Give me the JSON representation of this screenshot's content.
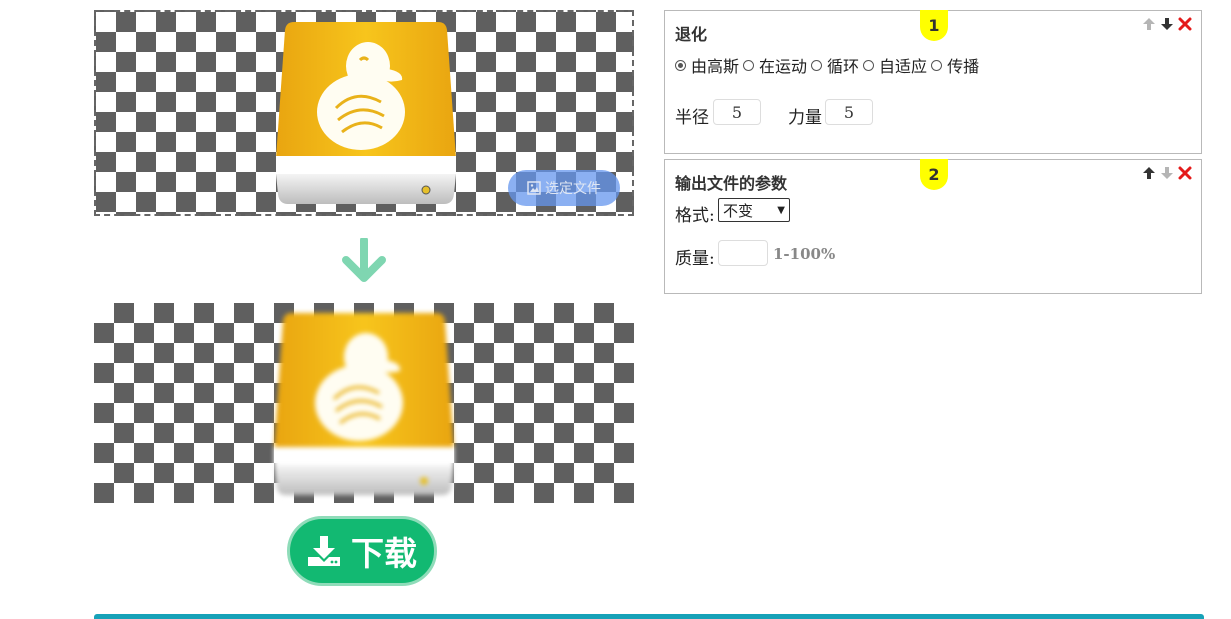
{
  "input_preview": {
    "select_file_label": "选定文件",
    "icon": "image-file-icon"
  },
  "arrow_icon": "arrow-down-icon",
  "download": {
    "label": "下载",
    "icon": "download-icon"
  },
  "panel_degrade": {
    "title": "退化",
    "badge": "1",
    "options": [
      "由高斯",
      "在运动",
      "循环",
      "自适应",
      "传播"
    ],
    "selected": "由高斯",
    "radius_label": "半径",
    "radius_value": "5",
    "strength_label": "力量",
    "strength_value": "5"
  },
  "panel_output": {
    "title": "输出文件的参数",
    "badge": "2",
    "format_label": "格式:",
    "format_value": "不变",
    "quality_label": "质量:",
    "quality_value": "",
    "quality_hint": "1-100%"
  },
  "colors": {
    "download_green": "#12b972",
    "badge_yellow": "#ffff00",
    "arrow_mint": "#7fd6b1",
    "delete_red": "#e41b1b",
    "bar_teal": "#17a2b8"
  }
}
